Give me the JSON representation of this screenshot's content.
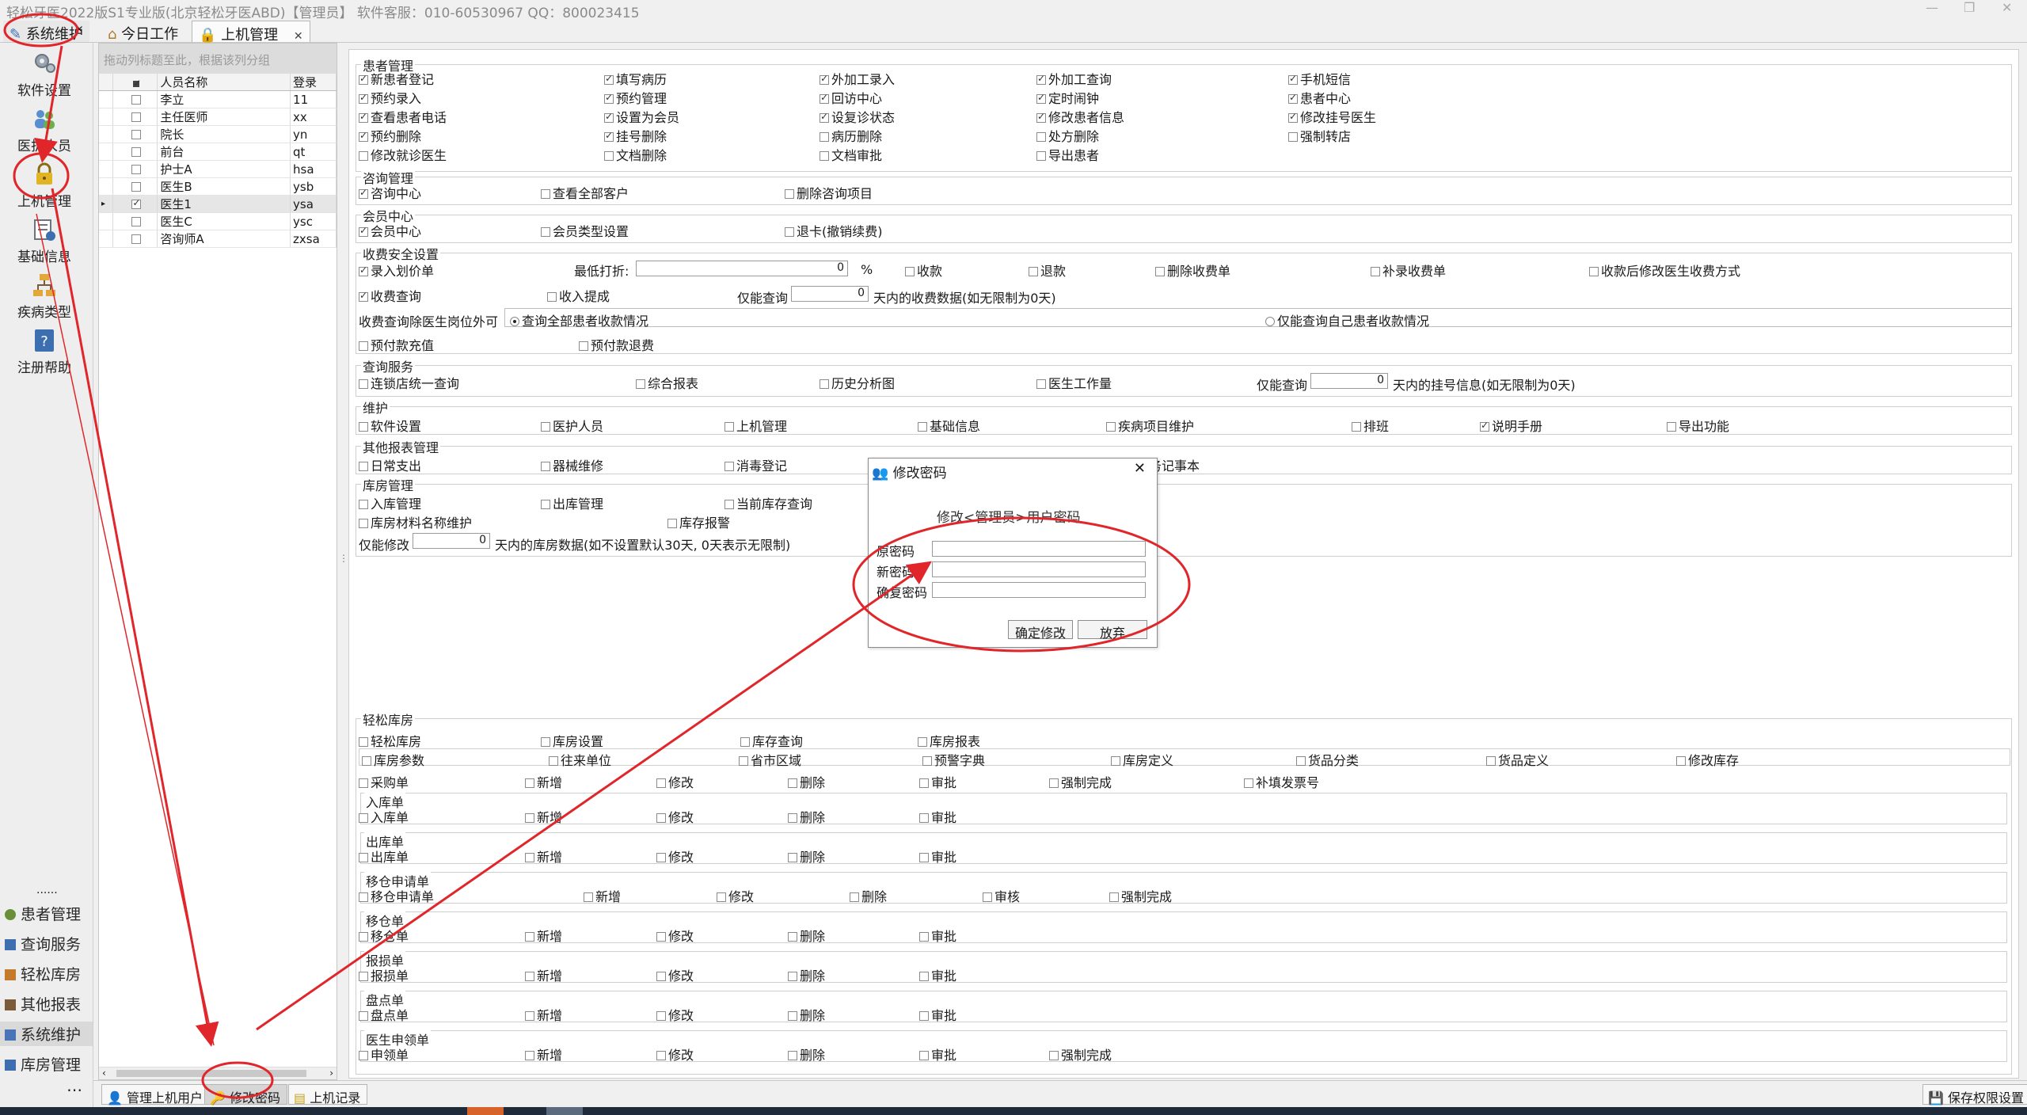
{
  "window": {
    "title": "轻松牙医2022版S1专业版(北京轻松牙医ABD)【管理员】    软件客服：010-60530967 QQ：800023415",
    "min": "—",
    "restore": "❐",
    "close": "✕"
  },
  "tabs": [
    {
      "label": "系统维护"
    },
    {
      "label": "今日工作"
    },
    {
      "label": "上机管理",
      "close": "✕"
    }
  ],
  "collapse_arrow": "‹",
  "nav": {
    "top": [
      {
        "label": "软件设置",
        "icon": "gear-icon"
      },
      {
        "label": "医护人员",
        "icon": "staff-icon"
      },
      {
        "label": "上机管理",
        "icon": "lock-icon"
      },
      {
        "label": "基础信息",
        "icon": "info-icon"
      },
      {
        "label": "疾病类型",
        "icon": "tree-icon"
      },
      {
        "label": "注册帮助",
        "icon": "help-icon"
      }
    ],
    "dots": "......",
    "list": [
      {
        "label": "患者管理",
        "color": "#6a8f3a"
      },
      {
        "label": "查询服务",
        "color": "#3d6fb0"
      },
      {
        "label": "轻松库房",
        "color": "#c47a2a"
      },
      {
        "label": "其他报表",
        "color": "#7a5b3a"
      },
      {
        "label": "系统维护",
        "color": "#4a74b8"
      },
      {
        "label": "库房管理",
        "color": "#3d6fb0"
      }
    ],
    "more": "⋯"
  },
  "users": {
    "group_hint": "拖动列标题至此，根据该列分组",
    "headers": [
      "人员名称",
      "登录"
    ],
    "rows": [
      {
        "name": "李立",
        "login": "11",
        "checked": false,
        "current": false
      },
      {
        "name": "主任医师",
        "login": "xx",
        "checked": false,
        "current": false
      },
      {
        "name": "院长",
        "login": "yn",
        "checked": false,
        "current": false
      },
      {
        "name": "前台",
        "login": "qt",
        "checked": false,
        "current": false
      },
      {
        "name": "护士A",
        "login": "hsa",
        "checked": false,
        "current": false
      },
      {
        "name": "医生B",
        "login": "ysb",
        "checked": false,
        "current": false
      },
      {
        "name": "医生1",
        "login": "ysa",
        "checked": true,
        "current": true
      },
      {
        "name": "医生C",
        "login": "ysc",
        "checked": false,
        "current": false
      },
      {
        "name": "咨询师A",
        "login": "zxsa",
        "checked": false,
        "current": false
      }
    ]
  },
  "perm": {
    "patient": {
      "title": "患者管理",
      "items": [
        [
          "新患者登记",
          true
        ],
        [
          "填写病历",
          true
        ],
        [
          "外加工录入",
          true
        ],
        [
          "外加工查询",
          true
        ],
        [
          "手机短信",
          true
        ],
        [
          "预约录入",
          true
        ],
        [
          "预约管理",
          true
        ],
        [
          "回访中心",
          true
        ],
        [
          "定时闹钟",
          true
        ],
        [
          "患者中心",
          true
        ],
        [
          "查看患者电话",
          true
        ],
        [
          "设置为会员",
          true
        ],
        [
          "设复诊状态",
          true
        ],
        [
          "修改患者信息",
          true
        ],
        [
          "修改挂号医生",
          true
        ],
        [
          "预约删除",
          true
        ],
        [
          "挂号删除",
          true
        ],
        [
          "病历删除",
          false
        ],
        [
          "处方删除",
          false
        ],
        [
          "强制转店",
          false
        ],
        [
          "修改就诊医生",
          false
        ],
        [
          "文档删除",
          false
        ],
        [
          "文档审批",
          false
        ],
        [
          "导出患者",
          false
        ]
      ]
    },
    "consult": {
      "title": "咨询管理",
      "items": [
        [
          "咨询中心",
          true
        ],
        [
          "查看全部客户",
          false
        ],
        [
          "删除咨询项目",
          false
        ]
      ]
    },
    "member": {
      "title": "会员中心",
      "items": [
        [
          "会员中心",
          true
        ],
        [
          "会员类型设置",
          false
        ],
        [
          "退卡(撤销续费)",
          false
        ]
      ]
    },
    "charge": {
      "title": "收费安全设置",
      "entry": [
        "录入划价单",
        true
      ],
      "discount_label": "最低打折:",
      "discount_value": "0",
      "percent": "%",
      "row1": [
        [
          "收款",
          false
        ],
        [
          "退款",
          false
        ],
        [
          "删除收费单",
          false
        ],
        [
          "补录收费单",
          false
        ],
        [
          "收款后修改医生收费方式",
          false
        ]
      ],
      "query": [
        "收费查询",
        true
      ],
      "bonus": [
        "收入提成",
        false
      ],
      "only_query": "仅能查询",
      "days_value": "0",
      "days_text": "天内的收费数据(如无限制为0天)",
      "scope_label": "收费查询除医生岗位外可",
      "scope_all": "查询全部患者收款情况",
      "scope_self": "仅能查询自己患者收款情况",
      "prepay": [
        [
          "预付款充值",
          false
        ],
        [
          "预付款退费",
          false
        ]
      ]
    },
    "query": {
      "title": "查询服务",
      "items": [
        [
          "连锁店统一查询",
          false
        ],
        [
          "综合报表",
          false
        ],
        [
          "历史分析图",
          false
        ],
        [
          "医生工作量",
          false
        ]
      ],
      "only_query": "仅能查询",
      "days_value": "0",
      "days_text": "天内的挂号信息(如无限制为0天)"
    },
    "maint": {
      "title": "维护",
      "items": [
        [
          "软件设置",
          false
        ],
        [
          "医护人员",
          false
        ],
        [
          "上机管理",
          false
        ],
        [
          "基础信息",
          false
        ],
        [
          "疾病项目维护",
          false
        ],
        [
          "排班",
          false
        ],
        [
          "说明手册",
          true
        ],
        [
          "导出功能",
          false
        ]
      ]
    },
    "other": {
      "title": "其他报表管理",
      "items": [
        [
          "日常支出",
          false
        ],
        [
          "器械维修",
          false
        ],
        [
          "消毒登记",
          false
        ]
      ],
      "tail": "务记事本"
    },
    "store": {
      "title": "库房管理",
      "items": [
        [
          "入库管理",
          false
        ],
        [
          "出库管理",
          false
        ],
        [
          "当前库存查询",
          false
        ],
        [
          "库房材料名称维护",
          false
        ],
        [
          "库存报警",
          false
        ]
      ],
      "only_modify": "仅能修改",
      "days_value": "0",
      "days_text": "天内的库房数据(如不设置默认30天, 0天表示无限制)"
    },
    "light": {
      "title": "轻松库房",
      "top": [
        [
          "轻松库房",
          false
        ],
        [
          "库房设置",
          false
        ],
        [
          "库存查询",
          false
        ],
        [
          "库房报表",
          false
        ]
      ],
      "params": [
        [
          "库房参数",
          false
        ],
        [
          "往来单位",
          false
        ],
        [
          "省市区域",
          false
        ],
        [
          "预警字典",
          false
        ],
        [
          "库房定义",
          false
        ],
        [
          "货品分类",
          false
        ],
        [
          "货品定义",
          false
        ],
        [
          "修改库存",
          false
        ]
      ],
      "purchase": [
        [
          "采购单",
          false
        ],
        [
          "新增",
          false
        ],
        [
          "修改",
          false
        ],
        [
          "删除",
          false
        ],
        [
          "审批",
          false
        ],
        [
          "强制完成",
          false
        ],
        [
          "补填发票号",
          false
        ]
      ],
      "groups": [
        {
          "title": "入库单",
          "items": [
            [
              "入库单",
              false
            ],
            [
              "新增",
              false
            ],
            [
              "修改",
              false
            ],
            [
              "删除",
              false
            ],
            [
              "审批",
              false
            ]
          ]
        },
        {
          "title": "出库单",
          "items": [
            [
              "出库单",
              false
            ],
            [
              "新增",
              false
            ],
            [
              "修改",
              false
            ],
            [
              "删除",
              false
            ],
            [
              "审批",
              false
            ]
          ]
        },
        {
          "title": "移仓申请单",
          "items": [
            [
              "移仓申请单",
              false
            ],
            [
              "新增",
              false
            ],
            [
              "修改",
              false
            ],
            [
              "删除",
              false
            ],
            [
              "审核",
              false
            ],
            [
              "强制完成",
              false
            ]
          ]
        },
        {
          "title": "移仓单",
          "items": [
            [
              "移仓单",
              false
            ],
            [
              "新增",
              false
            ],
            [
              "修改",
              false
            ],
            [
              "删除",
              false
            ],
            [
              "审批",
              false
            ]
          ]
        },
        {
          "title": "报损单",
          "items": [
            [
              "报损单",
              false
            ],
            [
              "新增",
              false
            ],
            [
              "修改",
              false
            ],
            [
              "删除",
              false
            ],
            [
              "审批",
              false
            ]
          ]
        },
        {
          "title": "盘点单",
          "items": [
            [
              "盘点单",
              false
            ],
            [
              "新增",
              false
            ],
            [
              "修改",
              false
            ],
            [
              "删除",
              false
            ],
            [
              "审批",
              false
            ]
          ]
        },
        {
          "title": "医生申领单",
          "items": [
            [
              "申领单",
              false
            ],
            [
              "新增",
              false
            ],
            [
              "修改",
              false
            ],
            [
              "删除",
              false
            ],
            [
              "审批",
              false
            ],
            [
              "强制完成",
              false
            ]
          ]
        }
      ]
    }
  },
  "dialog": {
    "title": "修改密码",
    "close": "✕",
    "heading": "修改<管理员>用户密码",
    "old_label": "原密码",
    "new_label": "新密码",
    "confirm_label": "确复密码",
    "ok": "确定修改",
    "cancel": "放弃"
  },
  "bottom": {
    "manage_users": "管理上机用户",
    "change_password": "修改密码",
    "login_log": "上机记录",
    "save_perm": "保存权限设置"
  },
  "annotation_color": "#e0262a"
}
